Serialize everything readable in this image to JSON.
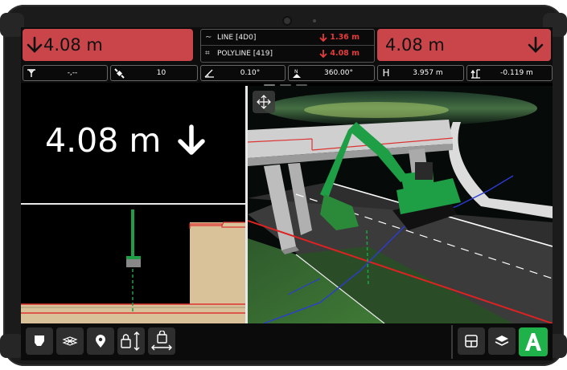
{
  "top": {
    "left_box": {
      "value": "4.08 m"
    },
    "right_box": {
      "value": "4.08 m"
    },
    "line_row": {
      "label": "LINE [4D0]",
      "value": "1.36 m"
    },
    "polyline_row": {
      "label": "POLYLINE [419]",
      "value": "4.08 m"
    }
  },
  "metrics": [
    {
      "icon": "gnss-antenna-icon",
      "value": "-,--"
    },
    {
      "icon": "satellite-icon",
      "value": "10"
    },
    {
      "icon": "slope-angle-icon",
      "value": "0.10°"
    },
    {
      "icon": "north-heading-icon",
      "value": "360.00°"
    },
    {
      "icon": "height-icon",
      "label": "H",
      "value": "3.957 m"
    },
    {
      "icon": "elevation-diff-icon",
      "value": "-0.119 m"
    }
  ],
  "main": {
    "big_reading": "4.08 m"
  },
  "colors": {
    "alert_red": "#c9454a",
    "accent_green": "#1fb24a",
    "excavator_green": "#1e9e45",
    "down_arrow_red": "#e63b3b"
  },
  "toolbar": {
    "left_buttons": [
      "bucket-icon",
      "surface-icon",
      "location-pin-icon",
      "lock-vertical-icon",
      "lock-horizontal-icon"
    ],
    "right_buttons": [
      "layout-icon",
      "layers-icon",
      "app-logo-icon"
    ]
  }
}
